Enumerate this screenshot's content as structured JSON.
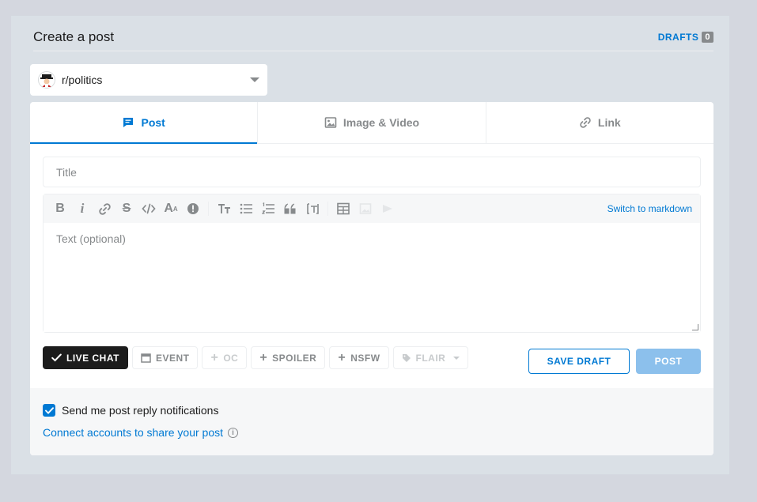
{
  "header": {
    "title": "Create a post",
    "drafts_label": "DRAFTS",
    "drafts_count": "0"
  },
  "community": {
    "name": "r/politics"
  },
  "tabs": [
    {
      "label": "Post",
      "icon": "post-icon",
      "active": true
    },
    {
      "label": "Image & Video",
      "icon": "image-icon",
      "active": false
    },
    {
      "label": "Link",
      "icon": "link-icon",
      "active": false
    }
  ],
  "form": {
    "title_placeholder": "Title",
    "text_placeholder": "Text (optional)",
    "switch_markdown": "Switch to markdown"
  },
  "toolbar": [
    "bold-icon",
    "italic-icon",
    "link-icon",
    "strikethrough-icon",
    "code-icon",
    "superscript-icon",
    "spoiler-icon",
    "heading-icon",
    "bulleted-list-icon",
    "numbered-list-icon",
    "quote-icon",
    "code-block-icon",
    "table-icon",
    "image-icon",
    "video-icon"
  ],
  "tags": {
    "live_chat": "LIVE CHAT",
    "event": "EVENT",
    "oc": "OC",
    "spoiler": "SPOILER",
    "nsfw": "NSFW",
    "flair": "FLAIR"
  },
  "actions": {
    "save_draft": "SAVE DRAFT",
    "post": "POST"
  },
  "footer": {
    "notifications": "Send me post reply notifications",
    "notifications_checked": true,
    "connect": "Connect accounts to share your post"
  },
  "colors": {
    "accent": "#0079d3",
    "post_disabled": "#8cc0ec",
    "background": "#dae0e6"
  }
}
